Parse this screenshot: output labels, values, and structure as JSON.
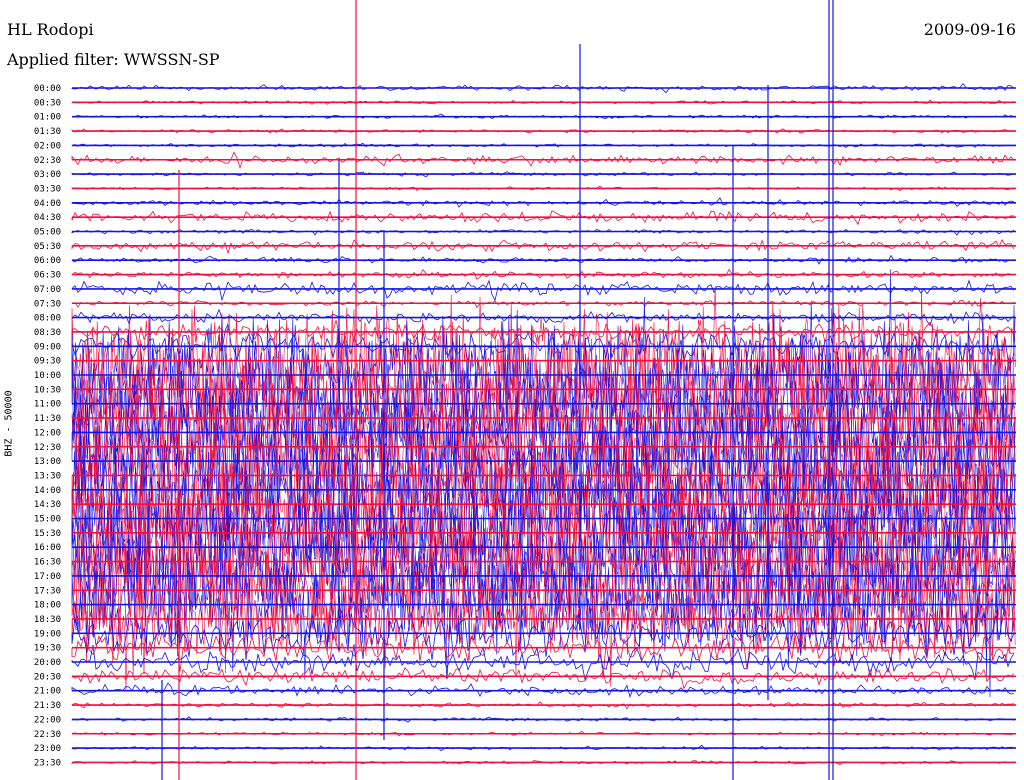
{
  "header": {
    "station": "HL Rodopi",
    "date": "2009-09-16",
    "filter": "Applied filter: WWSSN-SP",
    "channel": "BHZ - 50000"
  },
  "colors": {
    "even_trace": "#1414e6",
    "odd_trace": "#f01040",
    "text": "#000000"
  },
  "chart_data": {
    "type": "line",
    "title": "HL Rodopi",
    "subtitle": "Applied filter: WWSSN-SP",
    "ylabel": "BHZ - 50000",
    "xlabel": "",
    "row_labels": [
      "00:00",
      "00:30",
      "01:00",
      "01:30",
      "02:00",
      "02:30",
      "03:00",
      "03:30",
      "04:00",
      "04:30",
      "05:00",
      "05:30",
      "06:00",
      "06:30",
      "07:00",
      "07:30",
      "08:00",
      "08:30",
      "09:00",
      "09:30",
      "10:00",
      "10:30",
      "11:00",
      "11:30",
      "12:00",
      "12:30",
      "13:00",
      "13:30",
      "14:00",
      "14:30",
      "15:00",
      "15:30",
      "16:00",
      "16:30",
      "17:00",
      "17:30",
      "18:00",
      "18:30",
      "19:00",
      "19:30",
      "20:00",
      "20:30",
      "21:00",
      "21:30",
      "22:00",
      "22:30",
      "23:00",
      "23:30"
    ],
    "row_amplitude_level": [
      0.05,
      0.03,
      0.03,
      0.03,
      0.03,
      0.08,
      0.03,
      0.03,
      0.05,
      0.1,
      0.04,
      0.1,
      0.05,
      0.06,
      0.12,
      0.05,
      0.1,
      0.15,
      0.3,
      1,
      1,
      1,
      1,
      1,
      1,
      1,
      1,
      1,
      1,
      1,
      1,
      1,
      1,
      1,
      1,
      1,
      0.9,
      0.7,
      0.5,
      0.3,
      0.2,
      0.15,
      0.1,
      0.04,
      0.03,
      0.03,
      0.03,
      0.03
    ],
    "grid": false,
    "legend": "none"
  }
}
